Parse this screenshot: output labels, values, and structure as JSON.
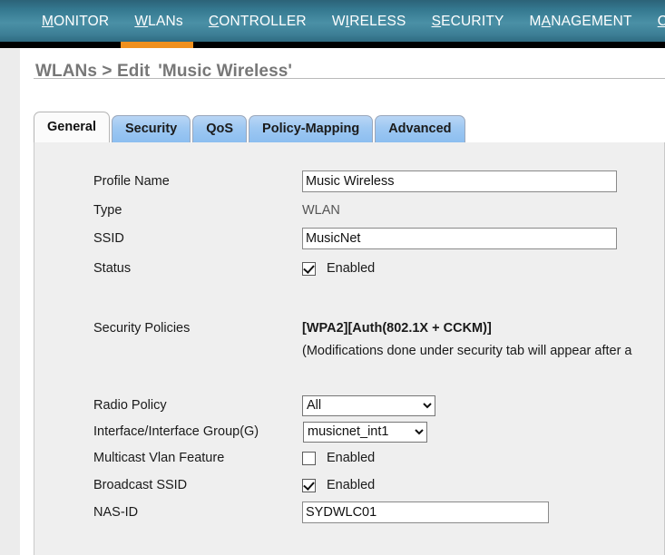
{
  "nav": {
    "items": [
      {
        "label": "MONITOR",
        "mnemonic": "M",
        "rest": "ONITOR",
        "active": false
      },
      {
        "label": "WLANs",
        "mnemonic": "W",
        "rest": "LANs",
        "active": true
      },
      {
        "label": "CONTROLLER",
        "mnemonic": "C",
        "rest": "ONTROLLER",
        "active": false
      },
      {
        "label": "WIRELESS",
        "mnemonic": "I",
        "pre": "W",
        "rest": "RELESS",
        "active": false
      },
      {
        "label": "SECURITY",
        "mnemonic": "S",
        "rest": "ECURITY",
        "active": false
      },
      {
        "label": "MANAGEMENT",
        "mnemonic": "A",
        "pre": "M",
        "rest": "NAGEMENT",
        "active": false
      },
      {
        "label": "C",
        "mnemonic": "C",
        "rest": "",
        "active": false
      }
    ],
    "active_indicator_color": "#f0901d",
    "bar_color": "#3d7f96"
  },
  "page": {
    "breadcrumb": "WLANs > Edit",
    "profile_title": "'Music Wireless'"
  },
  "tabs": [
    {
      "label": "General",
      "active": true
    },
    {
      "label": "Security",
      "active": false
    },
    {
      "label": "QoS",
      "active": false
    },
    {
      "label": "Policy-Mapping",
      "active": false
    },
    {
      "label": "Advanced",
      "active": false
    }
  ],
  "form": {
    "profile_name": {
      "label": "Profile Name",
      "value": "Music Wireless",
      "placeholder": ""
    },
    "type": {
      "label": "Type",
      "value": "WLAN"
    },
    "ssid": {
      "label": "SSID",
      "value": "MusicNet",
      "placeholder": ""
    },
    "status": {
      "label": "Status",
      "checkbox_label": "Enabled",
      "checked": true
    },
    "security_policies": {
      "label": "Security Policies",
      "value": "[WPA2][Auth(802.1X + CCKM)]",
      "note": "(Modifications done under security tab will appear after a"
    },
    "radio_policy": {
      "label": "Radio Policy",
      "value": "All",
      "options": [
        "All"
      ]
    },
    "interface_group": {
      "label": "Interface/Interface Group(G)",
      "value": "musicnet_int1",
      "options": [
        "musicnet_int1"
      ]
    },
    "multicast_vlan": {
      "label": "Multicast Vlan Feature",
      "checkbox_label": "Enabled",
      "checked": false
    },
    "broadcast_ssid": {
      "label": "Broadcast SSID",
      "checkbox_label": "Enabled",
      "checked": true
    },
    "nas_id": {
      "label": "NAS-ID",
      "value": "SYDWLC01",
      "placeholder": ""
    }
  }
}
